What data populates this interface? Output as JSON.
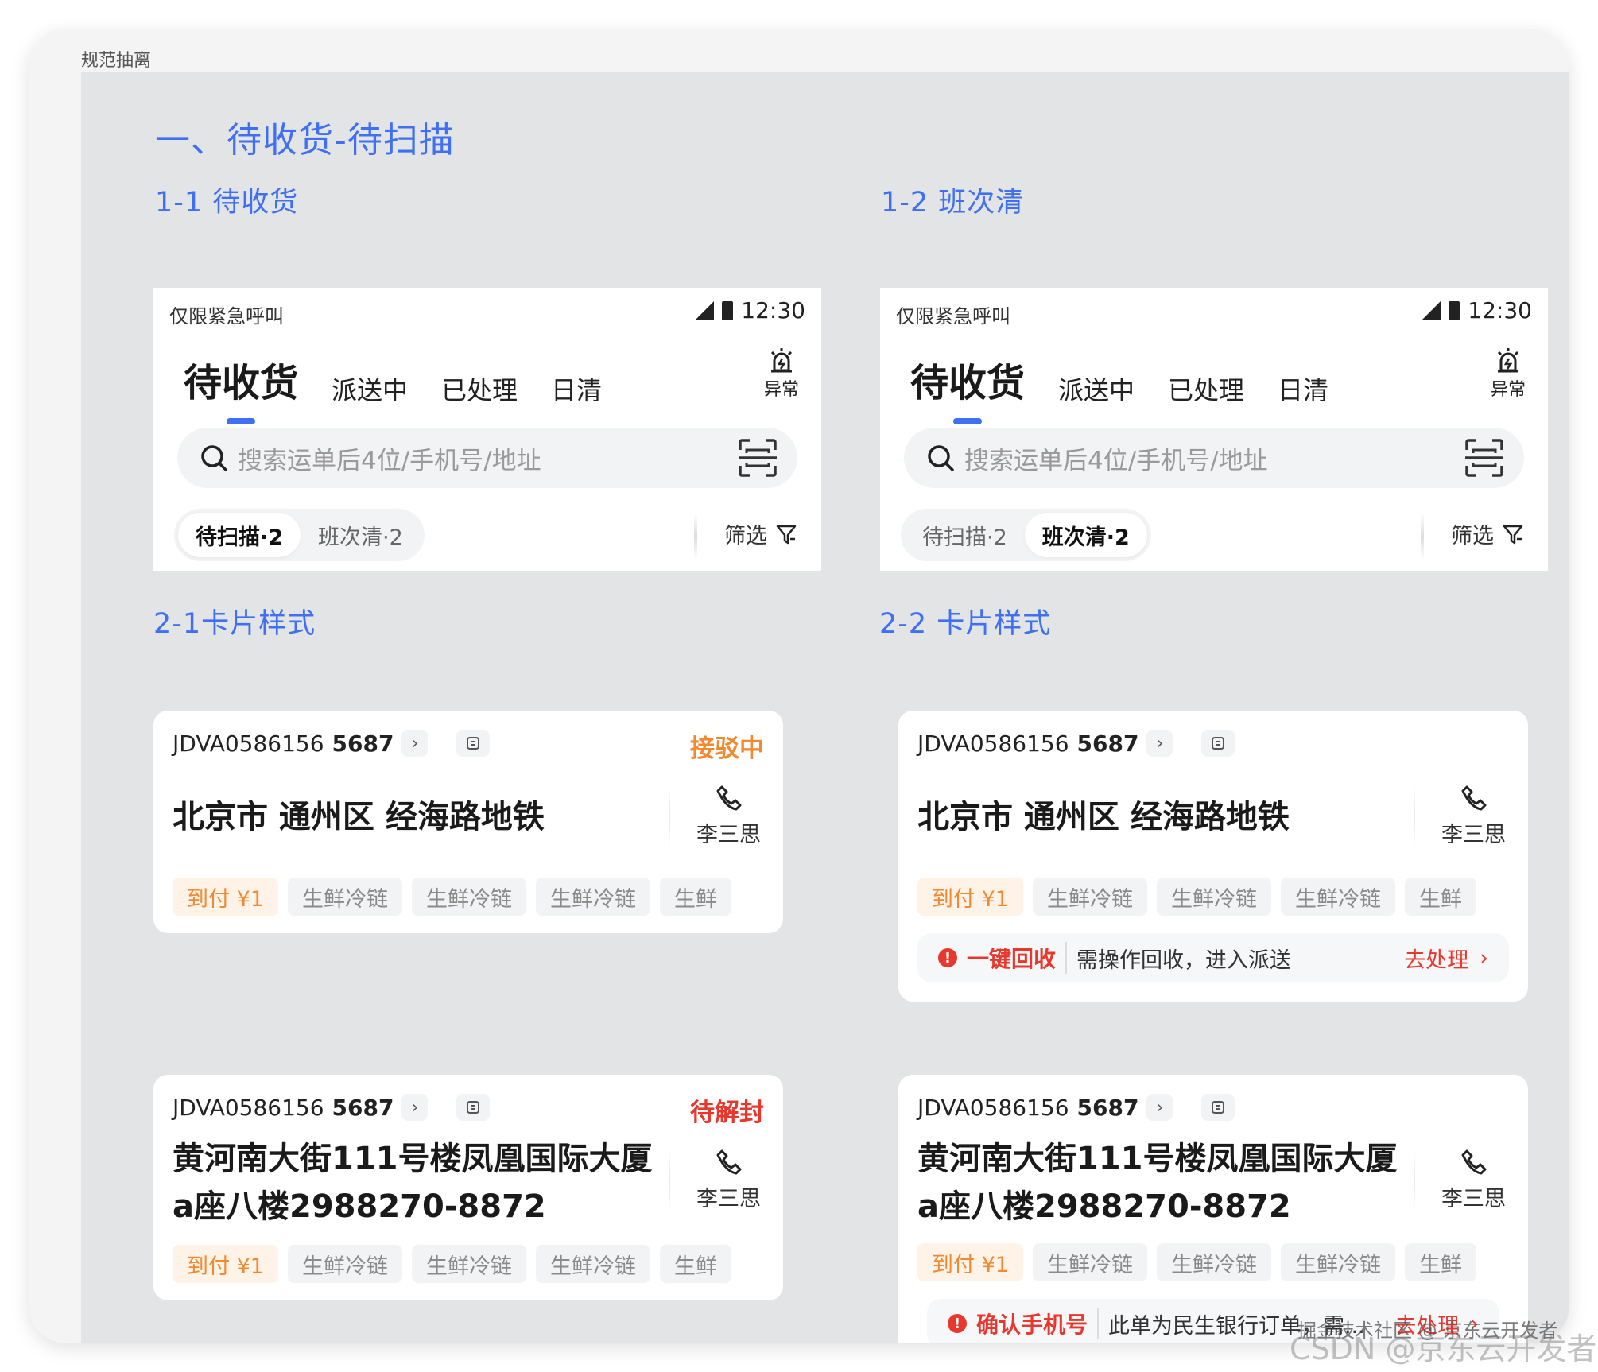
{
  "frame_label": "规范抽离",
  "section_title": "一、待收货-待扫描",
  "headers": {
    "h11": "1-1 待收货",
    "h12": "1-2 班次清",
    "h21": "2-1卡片样式",
    "h22": "2-2 卡片样式"
  },
  "phone": {
    "status_text": "仅限紧急呼叫",
    "time": "12:30",
    "tabs": [
      "待收货",
      "派送中",
      "已处理",
      "日清"
    ],
    "alarm_label": "异常",
    "search_placeholder": "搜索运单后4位/手机号/地址",
    "seg": [
      "待扫描·2",
      "班次清·2"
    ],
    "filter_label": "筛选"
  },
  "card": {
    "waybill_prefix": "JDVA0586156",
    "waybill_suffix": "5687",
    "contact_name": "李三思",
    "address_short": "北京市 通州区 经海路地铁",
    "address_long_1": "黄河南大街111号楼凤凰国际大厦",
    "address_long_2": "a座八楼2988270-8872",
    "status_rejecting": "接驳中",
    "status_unseal": "待解封",
    "tags": [
      "到付 ¥1",
      "生鲜冷链",
      "生鲜冷链",
      "生鲜冷链",
      "生鲜"
    ]
  },
  "alerts": {
    "recycle_title": "一键回收",
    "recycle_msg": "需操作回收，进入派送",
    "confirm_title": "确认手机号",
    "confirm_msg": "此单为民生银行订单，需...",
    "action": "去处理"
  },
  "watermarks": {
    "juejin": "掘金技术社区 @ 京东云开发者",
    "csdn": "CSDN @京东云开发者"
  },
  "colors": {
    "accent": "#3f6ff2",
    "orange": "#f2882f",
    "red": "#e8382d"
  }
}
